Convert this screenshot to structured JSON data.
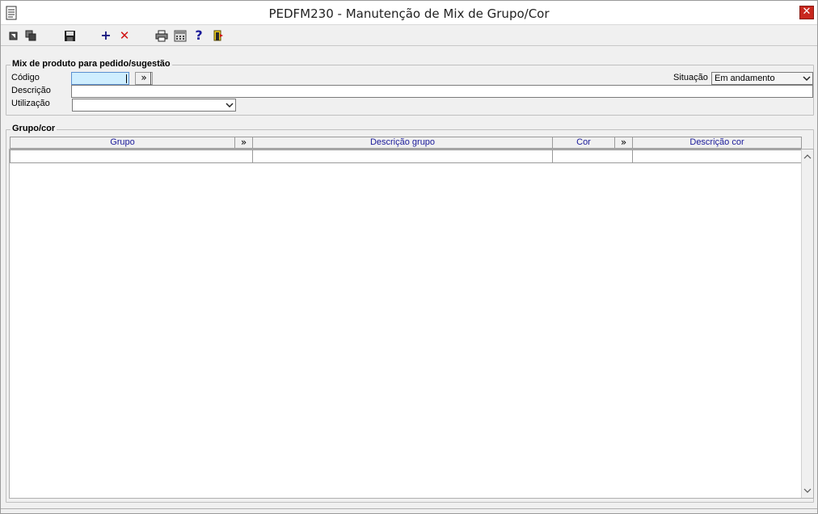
{
  "window": {
    "title": "PEDFM230 - Manutenção de Mix de Grupo/Cor",
    "close_glyph": "✕"
  },
  "toolbar": {
    "icons": [
      "first-record-icon",
      "copy-record-icon",
      "save-icon",
      "add-icon",
      "delete-icon",
      "print-icon",
      "calculator-icon",
      "help-icon",
      "exit-door-icon"
    ],
    "add_glyph": "+",
    "delete_glyph": "✕",
    "help_glyph": "?"
  },
  "mix_group": {
    "title": "Mix de produto para pedido/sugestão",
    "codigo_label": "Código",
    "codigo_value": "",
    "lookup_glyph": "»",
    "descricao_label": "Descrição",
    "descricao_value": "",
    "utilizacao_label": "Utilização",
    "utilizacao_value": "",
    "situacao_label": "Situação",
    "situacao_value": "Em andamento"
  },
  "grid_group": {
    "title": "Grupo/cor",
    "columns": {
      "grupo": "Grupo",
      "descricao_grupo": "Descrição grupo",
      "cor": "Cor",
      "descricao_cor": "Descrição cor"
    },
    "lookup_glyph": "»",
    "rows": []
  },
  "colors": {
    "focused_input": "#cfeeff",
    "header_text": "#1a1a9a",
    "close_red": "#c8281e"
  }
}
